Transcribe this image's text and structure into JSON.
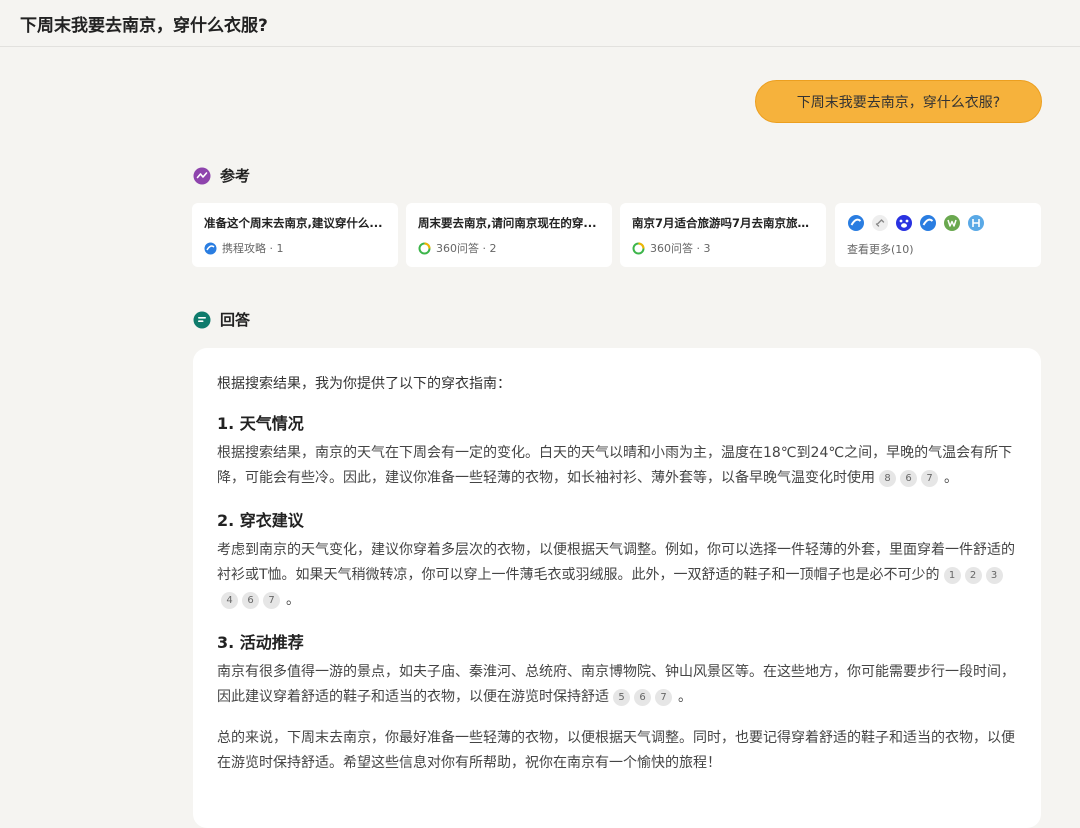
{
  "header": {
    "title": "下周末我要去南京，穿什么衣服?"
  },
  "user_message": "下周末我要去南京，穿什么衣服?",
  "references": {
    "heading": "参考",
    "cards": [
      {
        "title": "准备这个周末去南京,建议穿什么...",
        "source": "携程攻略 · 1",
        "icon": "ctrip-icon"
      },
      {
        "title": "周末要去南京,请问南京现在的穿...",
        "source": "360问答 · 2",
        "icon": "360-icon"
      },
      {
        "title": "南京7月适合旅游吗7月去南京旅游...",
        "source": "360问答 · 3",
        "icon": "360-icon"
      }
    ],
    "more_label": "查看更多(10)"
  },
  "answer": {
    "heading": "回答",
    "intro": "根据搜索结果，我为你提供了以下的穿衣指南：",
    "sections": [
      {
        "title": "1. 天气情况",
        "text": "根据搜索结果，南京的天气在下周会有一定的变化。白天的天气以晴和小雨为主，温度在18℃到24℃之间，早晚的气温会有所下降，可能会有些冷。因此，建议你准备一些轻薄的衣物，如长袖衬衫、薄外套等，以备早晚气温变化时使用",
        "citations": [
          "8",
          "6",
          "7"
        ]
      },
      {
        "title": "2. 穿衣建议",
        "text": "考虑到南京的天气变化，建议你穿着多层次的衣物，以便根据天气调整。例如，你可以选择一件轻薄的外套，里面穿着一件舒适的衬衫或T恤。如果天气稍微转凉，你可以穿上一件薄毛衣或羽绒服。此外，一双舒适的鞋子和一顶帽子也是必不可少的",
        "citations": [
          "1",
          "2",
          "3",
          "4",
          "6",
          "7"
        ]
      },
      {
        "title": "3. 活动推荐",
        "text": "南京有很多值得一游的景点，如夫子庙、秦淮河、总统府、南京博物院、钟山风景区等。在这些地方，你可能需要步行一段时间，因此建议穿着舒适的鞋子和适当的衣物，以便在游览时保持舒适",
        "citations": [
          "5",
          "6",
          "7"
        ]
      }
    ],
    "period": "。",
    "summary": "总的来说，下周末去南京，你最好准备一些轻薄的衣物，以便根据天气调整。同时，也要记得穿着舒适的鞋子和适当的衣物，以便在游览时保持舒适。希望这些信息对你有所帮助，祝你在南京有一个愉快的旅程！"
  },
  "colors": {
    "accent": "#f6b23c",
    "background": "#f5f4f1",
    "reference_icon": "#8e44ad",
    "answer_icon": "#0f7b6c"
  }
}
